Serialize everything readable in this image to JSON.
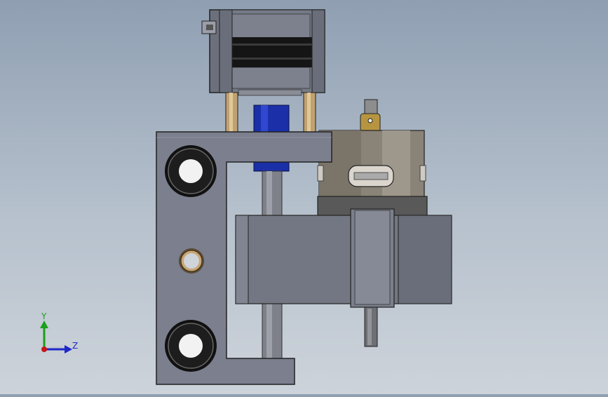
{
  "viewport": {
    "background_top": "#8f9fb2",
    "background_bottom": "#cdd3da"
  },
  "model": {
    "plate_color": "#7b7f8e",
    "motor_color": "#6f7380",
    "stripe_color": "#111111",
    "coupler_color": "#1a2fa8",
    "spindle_color": "#8a8377",
    "bushing_color": "#c8a676"
  },
  "triad": {
    "y_label": "Y",
    "z_label": "Z",
    "y_color": "#1aa01a",
    "z_color": "#1d28c8",
    "origin_color": "#c81818"
  }
}
